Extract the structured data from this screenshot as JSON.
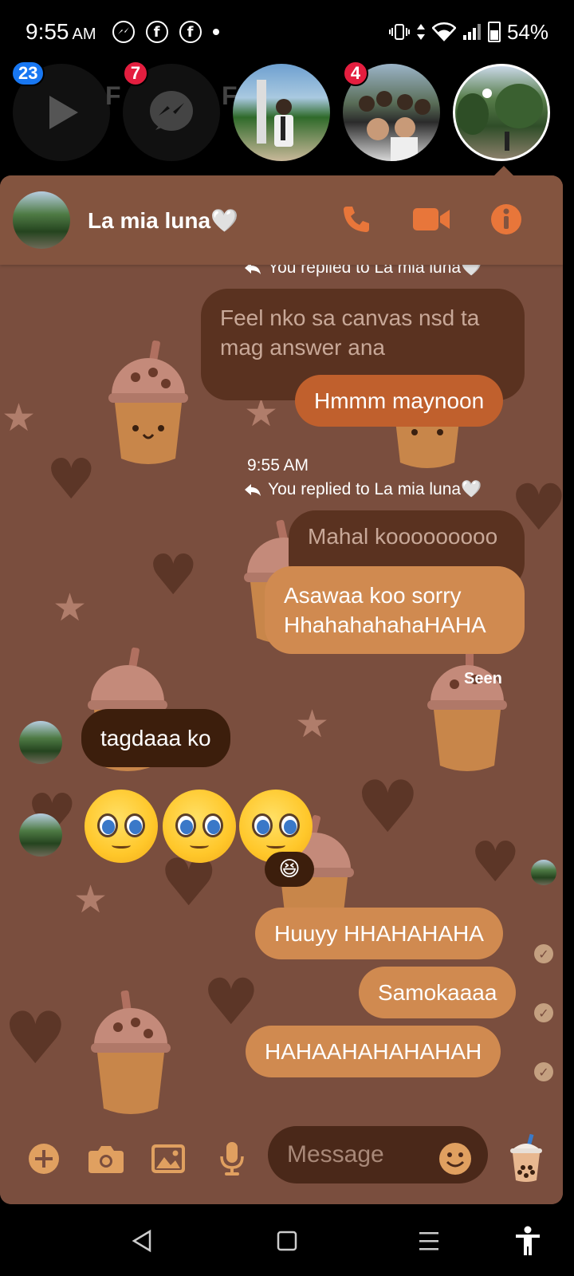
{
  "status_bar": {
    "time": "9:55",
    "ampm": "AM",
    "battery": "54%"
  },
  "chat_heads": {
    "badges": [
      "23",
      "7",
      "4"
    ],
    "faded_labels": [
      "F",
      "F"
    ]
  },
  "header": {
    "title": "La mia luna🤍"
  },
  "messages": {
    "reply_label_1": "You replied to La mia luna🤍",
    "quoted_1": "Feel nko sa canvas nsd ta mag answer ana",
    "sent_1": "Hmmm maynoon",
    "timestamp": "9:55 AM",
    "reply_label_2": "You replied to La mia luna🤍",
    "quoted_2": "Mahal kooooooooo",
    "sent_2": "Asawaa koo sorry HhahahahahaHAHA",
    "seen": "Seen",
    "received_1": "tagdaaa ko",
    "reaction_emoji": "😆",
    "sent_3": "Huuyy HHAHAHAHA",
    "sent_4": "Samokaaaa",
    "sent_5": "HAHAAHAHAHAHAH"
  },
  "composer": {
    "placeholder": "Message"
  },
  "colors": {
    "panel_bg": "#7a4e3e",
    "header_bg": "#83543f",
    "accent": "#e8763a",
    "sent_bubble": "#d08a50",
    "received_bubble": "#3c1e0c"
  }
}
